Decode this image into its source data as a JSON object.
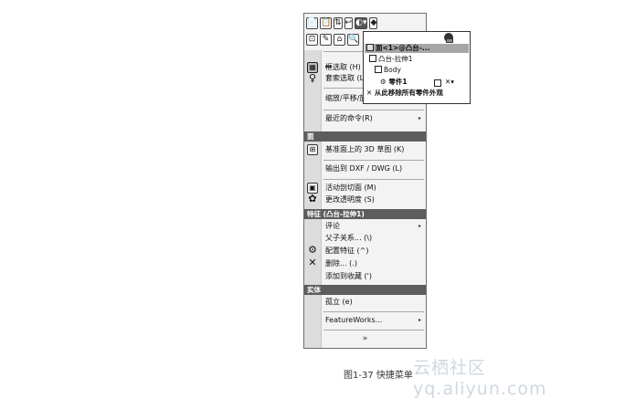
{
  "toolbar": {
    "row1": [
      "📄",
      "📋",
      "⇅",
      "↩"
    ],
    "row1_active": "◐▾",
    "row1_extra": "◆",
    "row2": [
      "⊡",
      "✎",
      "⌂",
      "🔍"
    ]
  },
  "appearance_panel": {
    "items": [
      {
        "label": "面<1>@凸台-..."
      },
      {
        "label": "凸台-拉伸1"
      },
      {
        "label": "Body"
      },
      {
        "label": "零件1"
      }
    ],
    "remove_label": "从此移除所有零件外观",
    "x_label": "✕▾"
  },
  "menu": {
    "items_top": [
      {
        "label": "框选取 (H)"
      },
      {
        "label": "套索选取 (L)"
      },
      {
        "label": "缩放/平移/旋"
      },
      {
        "label": "最近的命令(R)"
      }
    ],
    "section_face": {
      "title": "面"
    },
    "items_face": [
      {
        "label": "基准面上的 3D 草图 (K)"
      },
      {
        "label": "输出到 DXF / DWG (L)"
      },
      {
        "label": "活动剖切面 (M)"
      },
      {
        "label": "更改透明度 (S)"
      }
    ],
    "section_feature": {
      "title": "特征 (凸台-拉伸1)"
    },
    "items_feature": [
      {
        "label": "评论"
      },
      {
        "label": "父子关系... (\\)"
      },
      {
        "label": "配置特征 (^)"
      },
      {
        "label": "删除... (.)"
      },
      {
        "label": "添加到收藏 (')"
      }
    ],
    "section_solid": {
      "title": "实体"
    },
    "items_solid": [
      {
        "label": "孤立 (e)"
      },
      {
        "label": "FeatureWorks..."
      }
    ],
    "submenu_arrow": "▸",
    "expand_chevron": "»"
  },
  "caption": "图1-37 快捷菜单",
  "watermark": "云栖社区 yq.aliyun.com"
}
